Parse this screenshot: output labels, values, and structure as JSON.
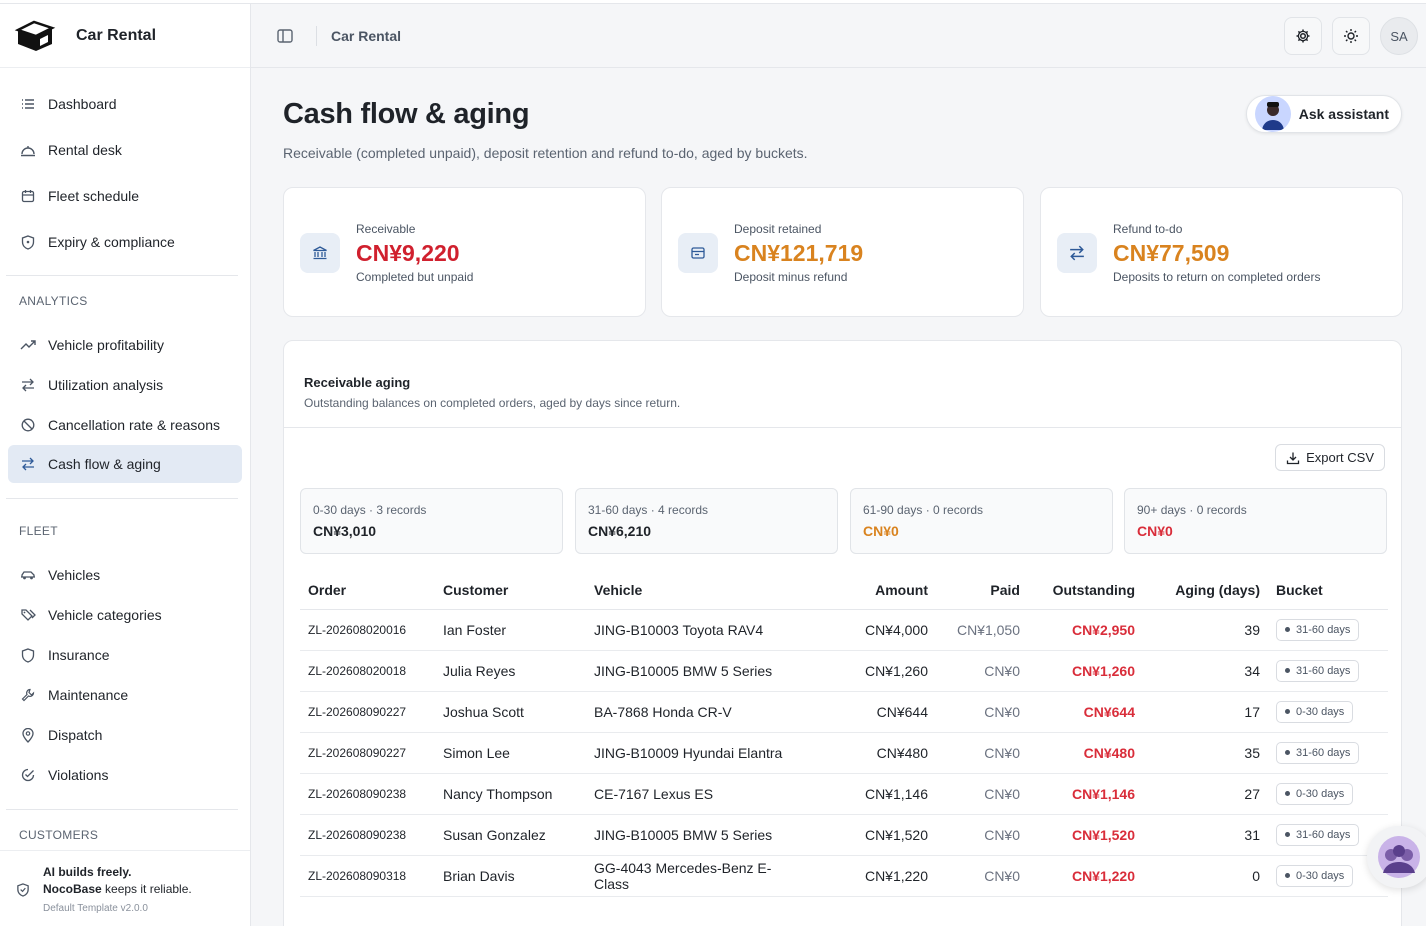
{
  "app": {
    "name": "Car Rental"
  },
  "header": {
    "breadcrumb": "Car Rental",
    "user_initials": "SA"
  },
  "sidebar": {
    "items_top": [
      {
        "label": "Dashboard",
        "icon": "list-icon"
      },
      {
        "label": "Rental desk",
        "icon": "desk-bell-icon"
      },
      {
        "label": "Fleet schedule",
        "icon": "calendar-icon"
      },
      {
        "label": "Expiry & compliance",
        "icon": "shield-icon"
      }
    ],
    "group_analytics": "ANALYTICS",
    "items_analytics": [
      {
        "label": "Vehicle profitability",
        "icon": "trending-up-icon"
      },
      {
        "label": "Utilization analysis",
        "icon": "arrows-swap-icon"
      },
      {
        "label": "Cancellation rate & reasons",
        "icon": "ban-icon"
      },
      {
        "label": "Cash flow & aging",
        "icon": "arrows-swap-icon",
        "active": true
      }
    ],
    "group_fleet": "FLEET",
    "items_fleet": [
      {
        "label": "Vehicles",
        "icon": "car-icon"
      },
      {
        "label": "Vehicle categories",
        "icon": "tags-icon"
      },
      {
        "label": "Insurance",
        "icon": "shield-check-icon"
      },
      {
        "label": "Maintenance",
        "icon": "wrench-icon"
      },
      {
        "label": "Dispatch",
        "icon": "map-pin-icon"
      },
      {
        "label": "Violations",
        "icon": "check-circle-icon"
      }
    ],
    "group_customers": "CUSTOMERS",
    "footer": {
      "line1": "AI builds freely.",
      "brand": "NocoBase",
      "line2_rest": " keeps it reliable.",
      "version": "Default Template v2.0.0"
    }
  },
  "page": {
    "title": "Cash flow & aging",
    "subtitle": "Receivable (completed unpaid), deposit retention and refund to-do, aged by buckets.",
    "ask_label": "Ask assistant"
  },
  "stats": [
    {
      "label": "Receivable",
      "value": "CN¥9,220",
      "note": "Completed but unpaid",
      "color": "#d0202e",
      "icon": "bank-icon"
    },
    {
      "label": "Deposit retained",
      "value": "CN¥121,719",
      "note": "Deposit minus refund",
      "color": "#d9831f",
      "icon": "wallet-icon"
    },
    {
      "label": "Refund to-do",
      "value": "CN¥77,509",
      "note": "Deposits to return on completed orders",
      "color": "#d9831f",
      "icon": "arrows-swap-icon"
    }
  ],
  "aging": {
    "title": "Receivable aging",
    "subtitle": "Outstanding balances on completed orders, aged by days since return.",
    "export_label": "Export CSV",
    "buckets": [
      {
        "label": "0-30 days · 3 records",
        "amount": "CN¥3,010"
      },
      {
        "label": "31-60 days · 4 records",
        "amount": "CN¥6,210"
      },
      {
        "label": "61-90 days · 0 records",
        "amount": "CN¥0"
      },
      {
        "label": "90+ days · 0 records",
        "amount": "CN¥0"
      }
    ],
    "columns": [
      "Order",
      "Customer",
      "Vehicle",
      "Amount",
      "Paid",
      "Outstanding",
      "Aging (days)",
      "Bucket"
    ],
    "rows": [
      [
        "ZL-202608020016",
        "Ian Foster",
        "JING-B10003 Toyota RAV4",
        "CN¥4,000",
        "CN¥1,050",
        "CN¥2,950",
        "39",
        "31-60 days"
      ],
      [
        "ZL-202608020018",
        "Julia Reyes",
        "JING-B10005 BMW 5 Series",
        "CN¥1,260",
        "CN¥0",
        "CN¥1,260",
        "34",
        "31-60 days"
      ],
      [
        "ZL-202608090227",
        "Joshua Scott",
        "BA-7868 Honda CR-V",
        "CN¥644",
        "CN¥0",
        "CN¥644",
        "17",
        "0-30 days"
      ],
      [
        "ZL-202608090227",
        "Simon Lee",
        "JING-B10009 Hyundai Elantra",
        "CN¥480",
        "CN¥0",
        "CN¥480",
        "35",
        "31-60 days"
      ],
      [
        "ZL-202608090238",
        "Nancy Thompson",
        "CE-7167 Lexus ES",
        "CN¥1,146",
        "CN¥0",
        "CN¥1,146",
        "27",
        "0-30 days"
      ],
      [
        "ZL-202608090238",
        "Susan Gonzalez",
        "JING-B10005 BMW 5 Series",
        "CN¥1,520",
        "CN¥0",
        "CN¥1,520",
        "31",
        "31-60 days"
      ],
      [
        "ZL-202608090318",
        "Brian Davis",
        "GG-4043 Mercedes-Benz E-Class",
        "CN¥1,220",
        "CN¥0",
        "CN¥1,220",
        "0",
        "0-30 days"
      ]
    ]
  }
}
